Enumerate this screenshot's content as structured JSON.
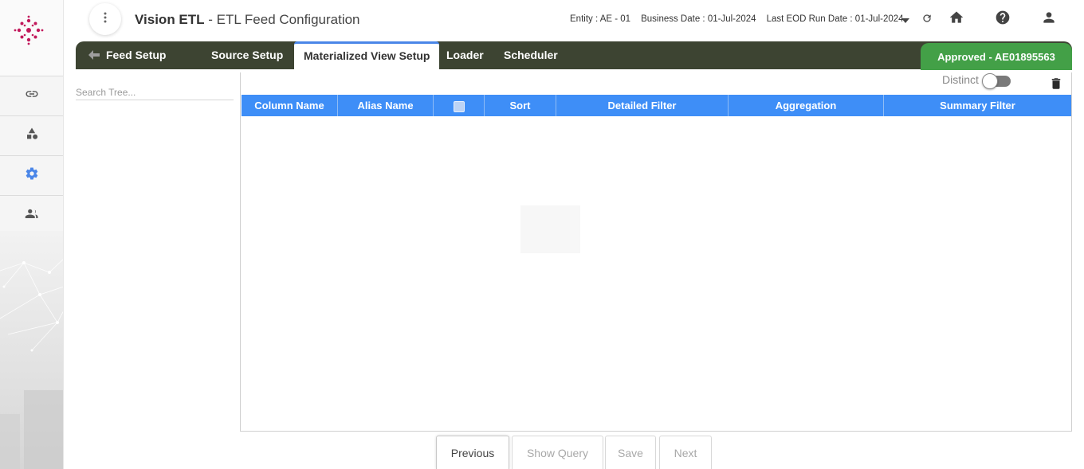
{
  "header": {
    "app_name": "Vision ETL",
    "page_title": " - ETL Feed Configuration",
    "entity_label": "Entity :",
    "entity_value": "AE - 01",
    "business_date_label": "Business Date :",
    "business_date_value": "01-Jul-2024",
    "eod_label": "Last EOD Run Date :",
    "eod_value": "01-Jul-2024"
  },
  "sidebar": {
    "items": [
      {
        "icon": "link-icon"
      },
      {
        "icon": "shapes-icon"
      },
      {
        "icon": "gear-icon",
        "active_color": "#4a86e8"
      },
      {
        "icon": "users-icon"
      }
    ]
  },
  "tabs": {
    "feed_setup": "Feed Setup",
    "source_setup": "Source Setup",
    "materialized_view_setup": "Materialized View Setup",
    "loader": "Loader",
    "scheduler": "Scheduler",
    "active": "Materialized View Setup"
  },
  "status": {
    "approved_text": "Approved - AE01895563",
    "color": "#43a047"
  },
  "tree": {
    "search_placeholder": "Search Tree..."
  },
  "grid": {
    "distinct_label": "Distinct",
    "distinct_on": false,
    "columns": [
      "Column Name",
      "Alias Name",
      "",
      "Sort",
      "Detailed Filter",
      "Aggregation",
      "Summary Filter"
    ],
    "header_color": "#3e8ef7",
    "rows": []
  },
  "buttons": {
    "previous": "Previous",
    "show_query": "Show Query",
    "save": "Save",
    "next": "Next"
  },
  "colors": {
    "tabbar": "#3d4432",
    "accent": "#4a86e8",
    "logo": "#c2185b"
  }
}
